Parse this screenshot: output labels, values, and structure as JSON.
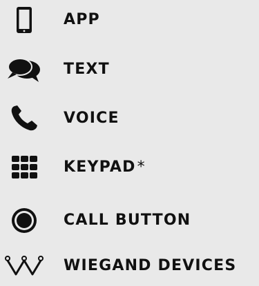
{
  "items": [
    {
      "label": "APP",
      "icon": "smartphone-icon"
    },
    {
      "label": "TEXT",
      "icon": "chat-bubbles-icon"
    },
    {
      "label": "VOICE",
      "icon": "phone-handset-icon"
    },
    {
      "label": "KEYPAD",
      "suffix": "*",
      "icon": "keypad-icon"
    },
    {
      "label": "CALL BUTTON",
      "icon": "record-button-icon"
    },
    {
      "label": "WIEGAND DEVICES",
      "icon": "wiegand-wave-icon"
    }
  ],
  "colors": {
    "background": "#e9e9e9",
    "foreground": "#111111"
  }
}
